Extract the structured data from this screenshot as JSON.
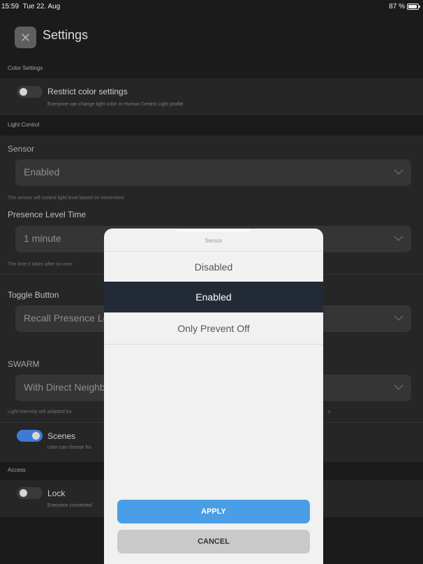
{
  "status_bar": {
    "time": "15:59",
    "date": "Tue 22. Aug",
    "battery": "87 %"
  },
  "header": {
    "title": "Settings",
    "close_icon": "close-icon"
  },
  "sections": {
    "color_settings": "Color Settings",
    "light_control": "Light Control",
    "access": "Access"
  },
  "color": {
    "toggle_title": "Restrict color settings",
    "toggle_sub": "Everyone can change light color or Human Centric Light profile",
    "toggle_on": false
  },
  "sensor": {
    "label": "Sensor",
    "value": "Enabled",
    "help": "The sensor will control light level based on movement."
  },
  "presence": {
    "label": "Presence Level Time",
    "value": "1 minute",
    "help": "The time it takes after no mov"
  },
  "toggle_button": {
    "label": "Toggle Button",
    "value": "Recall Presence Le"
  },
  "swarm": {
    "label": "SWARM",
    "value": "With Direct Neighb",
    "help_left": "Light intensity will adapted ba",
    "help_right": "s."
  },
  "scenes": {
    "title": "Scenes",
    "sub": "User can choose fro",
    "toggle_on": true
  },
  "lock": {
    "title": "Lock",
    "sub": "Everyone connected",
    "toggle_on": false
  },
  "modal": {
    "title": "Sensor",
    "options": [
      "Disabled",
      "Enabled",
      "Only Prevent Off"
    ],
    "selected": "Enabled",
    "apply": "APPLY",
    "cancel": "CANCEL"
  },
  "colors": {
    "accent": "#4a9ee6",
    "toggle_on": "#3f7bd6",
    "selected_row": "#222a36",
    "background": "#1b1b1b"
  }
}
